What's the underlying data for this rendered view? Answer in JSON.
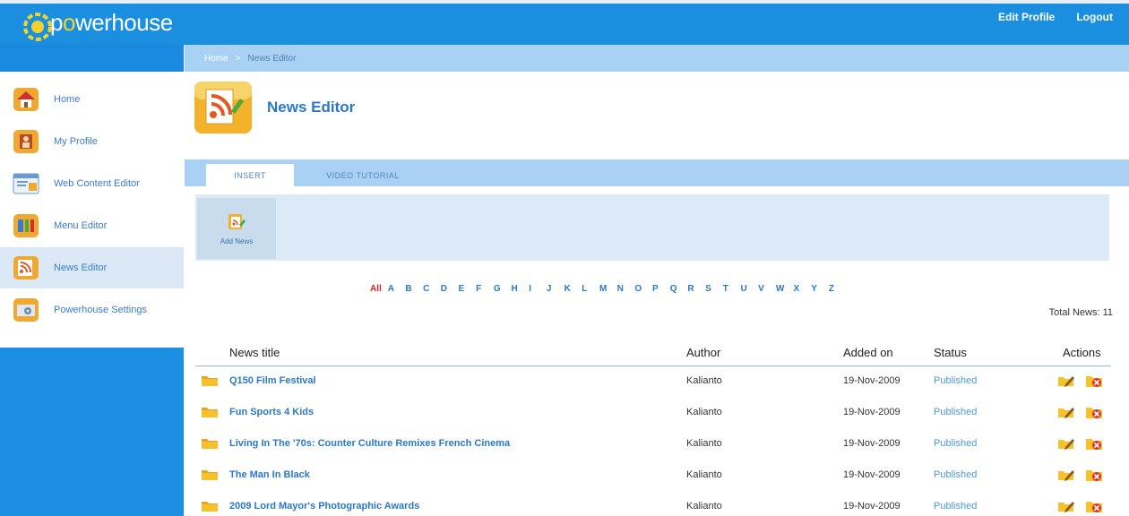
{
  "header": {
    "logo_prefix": "p",
    "logo_o": "o",
    "logo_rest": "werhouse",
    "edit_profile": "Edit Profile",
    "logout": "Logout"
  },
  "breadcrumb": {
    "home": "Home",
    "separator": ">",
    "current": "News Editor"
  },
  "sidebar": {
    "items": [
      {
        "label": "Home",
        "icon": "home-icon",
        "active": false
      },
      {
        "label": "My Profile",
        "icon": "profile-icon",
        "active": false
      },
      {
        "label": "Web Content Editor",
        "icon": "web-content-icon",
        "active": false
      },
      {
        "label": "Menu Editor",
        "icon": "menu-editor-icon",
        "active": false
      },
      {
        "label": "News Editor",
        "icon": "news-editor-icon",
        "active": true
      },
      {
        "label": "Powerhouse Settings",
        "icon": "settings-icon",
        "active": false
      }
    ]
  },
  "page": {
    "title": "News Editor",
    "icon": "news-feed-icon"
  },
  "tabs": [
    {
      "label": "INSERT",
      "active": true
    },
    {
      "label": "VIDEO TUTORIAL",
      "active": false
    }
  ],
  "toolbar": {
    "add_news_label": "Add News",
    "add_news_icon": "add-news-icon"
  },
  "letter_filter": {
    "letters": [
      "All",
      "A",
      "B",
      "C",
      "D",
      "E",
      "F",
      "G",
      "H",
      "I",
      "J",
      "K",
      "L",
      "M",
      "N",
      "O",
      "P",
      "Q",
      "R",
      "S",
      "T",
      "U",
      "V",
      "W",
      "X",
      "Y",
      "Z"
    ],
    "active": "All"
  },
  "total_news": "Total News: 11",
  "table": {
    "headers": {
      "title": "News title",
      "author": "Author",
      "added": "Added on",
      "status": "Status",
      "actions": "Actions"
    },
    "rows": [
      {
        "title": "Q150 Film Festival",
        "author": "Kalianto",
        "added": "19-Nov-2009",
        "status": "Published"
      },
      {
        "title": "Fun Sports 4 Kids",
        "author": "Kalianto",
        "added": "19-Nov-2009",
        "status": "Published"
      },
      {
        "title": "Living In The '70s: Counter Culture Remixes French Cinema",
        "author": "Kalianto",
        "added": "19-Nov-2009",
        "status": "Published"
      },
      {
        "title": "The Man In Black",
        "author": "Kalianto",
        "added": "19-Nov-2009",
        "status": "Published"
      },
      {
        "title": "2009 Lord Mayor's Photographic Awards",
        "author": "Kalianto",
        "added": "19-Nov-2009",
        "status": "Published"
      }
    ]
  },
  "colors": {
    "header_blue": "#1a8fe0",
    "breadcrumb_blue": "#a9d1f4",
    "link_blue": "#2a78c8",
    "active_letter_red": "#e02020",
    "folder_yellow": "#f6c12a"
  }
}
